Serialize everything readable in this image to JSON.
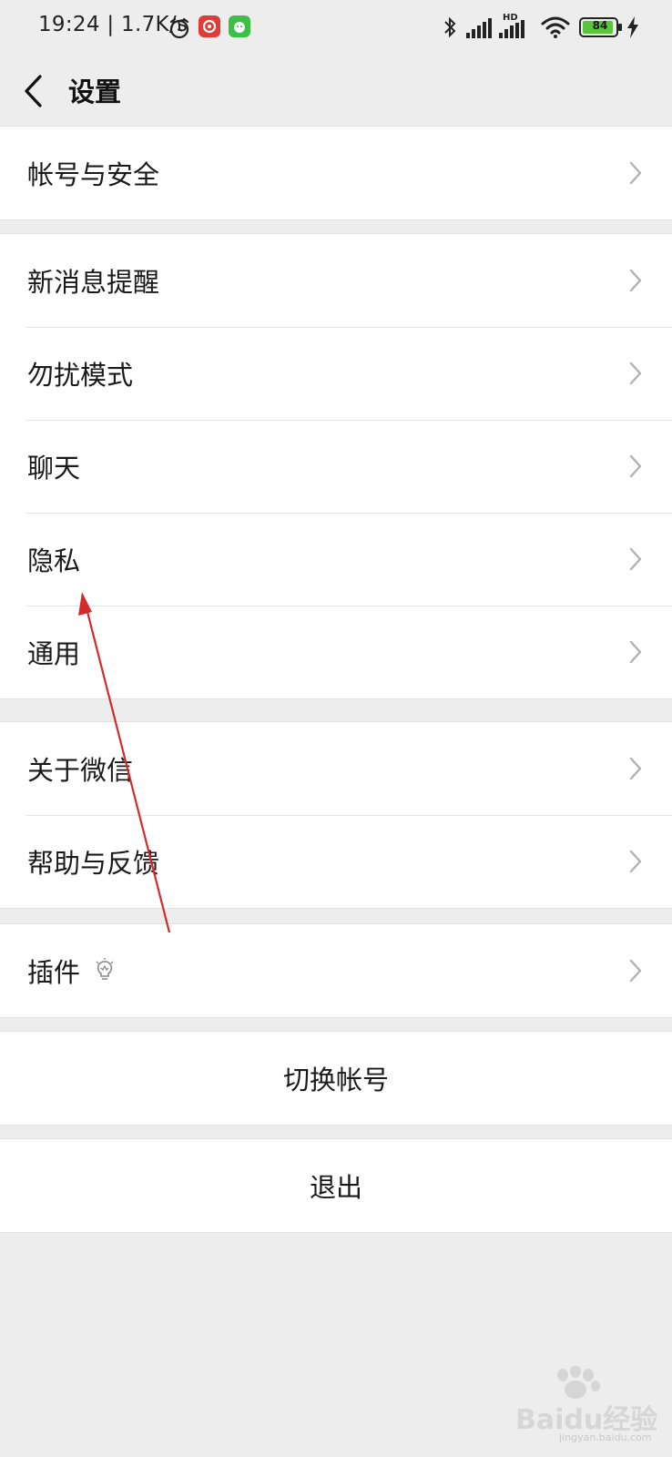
{
  "status_bar": {
    "time_speed": "19:24 | 1.7K/s",
    "battery_level": "84",
    "network_label": "HD"
  },
  "nav": {
    "title": "设置"
  },
  "groups": {
    "account": {
      "label": "帐号与安全"
    },
    "notifications": {
      "label": "新消息提醒"
    },
    "dnd": {
      "label": "勿扰模式"
    },
    "chat": {
      "label": "聊天"
    },
    "privacy": {
      "label": "隐私"
    },
    "general": {
      "label": "通用"
    },
    "about": {
      "label": "关于微信"
    },
    "help": {
      "label": "帮助与反馈"
    },
    "plugins": {
      "label": "插件"
    }
  },
  "actions": {
    "switch_account": "切换帐号",
    "logout": "退出"
  },
  "watermark": {
    "brand": "Baidu经验",
    "url": "jingyan.baidu.com"
  },
  "colors": {
    "background": "#ededed",
    "surface": "#ffffff",
    "text": "#1a1a1a",
    "chevron": "#b2b2b2",
    "annotation_arrow": "#d42a2a",
    "battery_fill": "#5ac43c"
  },
  "icons": {
    "back": "chevron-left-icon",
    "row_arrow": "chevron-right-icon",
    "plugin_badge": "lightbulb-icon"
  }
}
